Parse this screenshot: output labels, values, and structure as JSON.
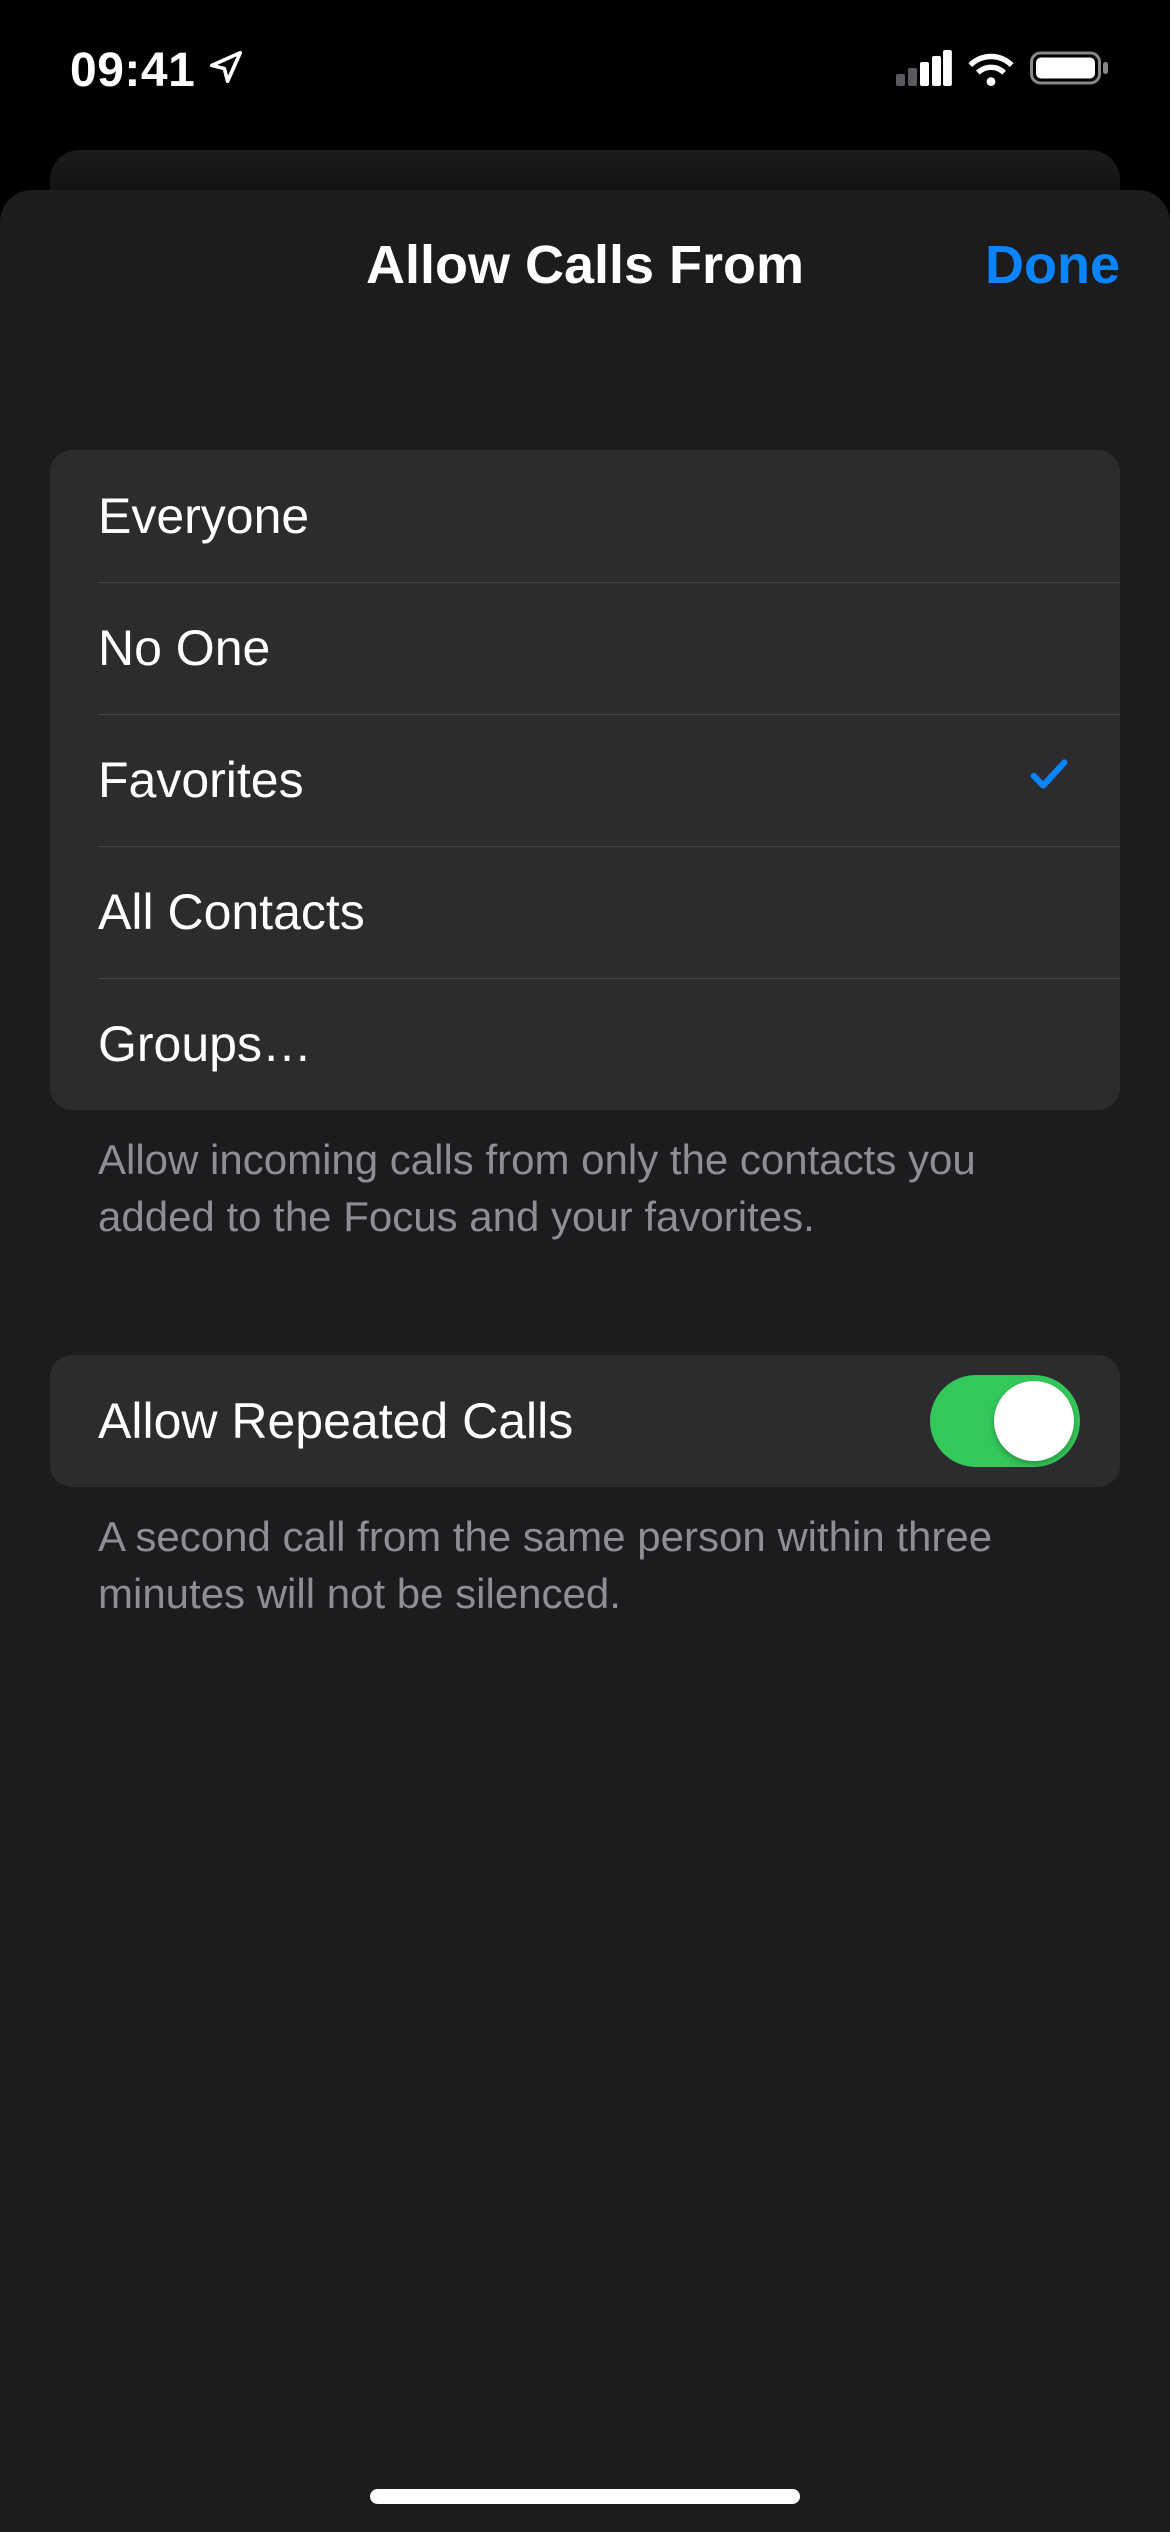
{
  "status": {
    "time": "09:41"
  },
  "nav": {
    "title": "Allow Calls From",
    "done": "Done"
  },
  "options": {
    "items": [
      {
        "label": "Everyone",
        "selected": false
      },
      {
        "label": "No One",
        "selected": false
      },
      {
        "label": "Favorites",
        "selected": true
      },
      {
        "label": "All Contacts",
        "selected": false
      },
      {
        "label": "Groups…",
        "selected": false
      }
    ],
    "footer": "Allow incoming calls from only the contacts you added to the Focus and your favorites."
  },
  "repeated": {
    "label": "Allow Repeated Calls",
    "on": true,
    "footer": "A second call from the same person within three minutes will not be silenced."
  }
}
